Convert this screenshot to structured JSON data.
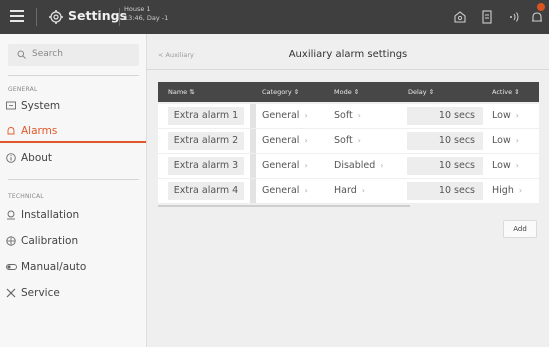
{
  "topbar": {
    "title": "Settings",
    "house_name": "House 1",
    "house_time": "13:46, Day -1"
  },
  "sidebar": {
    "search_placeholder": "Search",
    "general_label": "GENERAL",
    "technical_label": "TECHNICAL",
    "items": [
      {
        "label": "System",
        "icon": "monitor-icon"
      },
      {
        "label": "Alarms",
        "icon": "bell-icon"
      },
      {
        "label": "About",
        "icon": "info-icon"
      },
      {
        "label": "Installation",
        "icon": "installation-icon"
      },
      {
        "label": "Calibration",
        "icon": "calibration-icon"
      },
      {
        "label": "Manual/auto",
        "icon": "toggle-icon"
      },
      {
        "label": "Service",
        "icon": "tools-icon"
      }
    ],
    "active_index": 1,
    "accent": "#e0582a"
  },
  "main": {
    "breadcrumb": "< Auxiliary",
    "title": "Auxiliary alarm settings",
    "columns": [
      "Name ⇅",
      "Category ⇕",
      "Mode ⇕",
      "Delay ⇕",
      "Active ⇕"
    ],
    "rows": [
      {
        "name": "Extra alarm 1",
        "category": "General",
        "mode": "Soft",
        "delay": "10 secs",
        "active": "Low"
      },
      {
        "name": "Extra alarm 2",
        "category": "General",
        "mode": "Soft",
        "delay": "10 secs",
        "active": "Low"
      },
      {
        "name": "Extra alarm 3",
        "category": "General",
        "mode": "Disabled",
        "delay": "10 secs",
        "active": "Low"
      },
      {
        "name": "Extra alarm 4",
        "category": "General",
        "mode": "Hard",
        "delay": "10 secs",
        "active": "High"
      }
    ],
    "chevron": "›",
    "add_label": "Add"
  }
}
